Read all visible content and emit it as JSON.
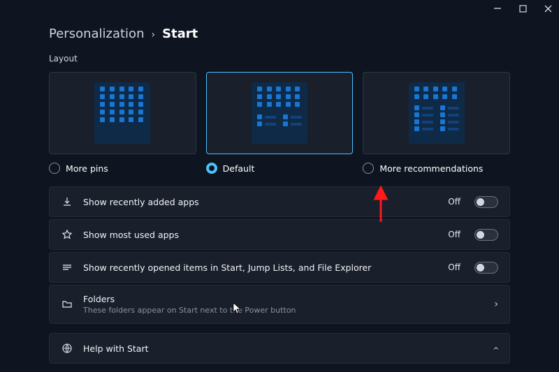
{
  "breadcrumb": {
    "parent": "Personalization",
    "current": "Start"
  },
  "section": {
    "layout_label": "Layout"
  },
  "layouts": {
    "more_pins": "More pins",
    "default": "Default",
    "more_rec": "More recommendations",
    "selected": "default"
  },
  "toggles": {
    "recent_apps": {
      "label": "Show recently added apps",
      "state": "Off"
    },
    "most_used": {
      "label": "Show most used apps",
      "state": "Off"
    },
    "recent_items": {
      "label": "Show recently opened items in Start, Jump Lists, and File Explorer",
      "state": "Off"
    }
  },
  "folders": {
    "label": "Folders",
    "sub": "These folders appear on Start next to the Power button"
  },
  "help": {
    "label": "Help with Start"
  }
}
